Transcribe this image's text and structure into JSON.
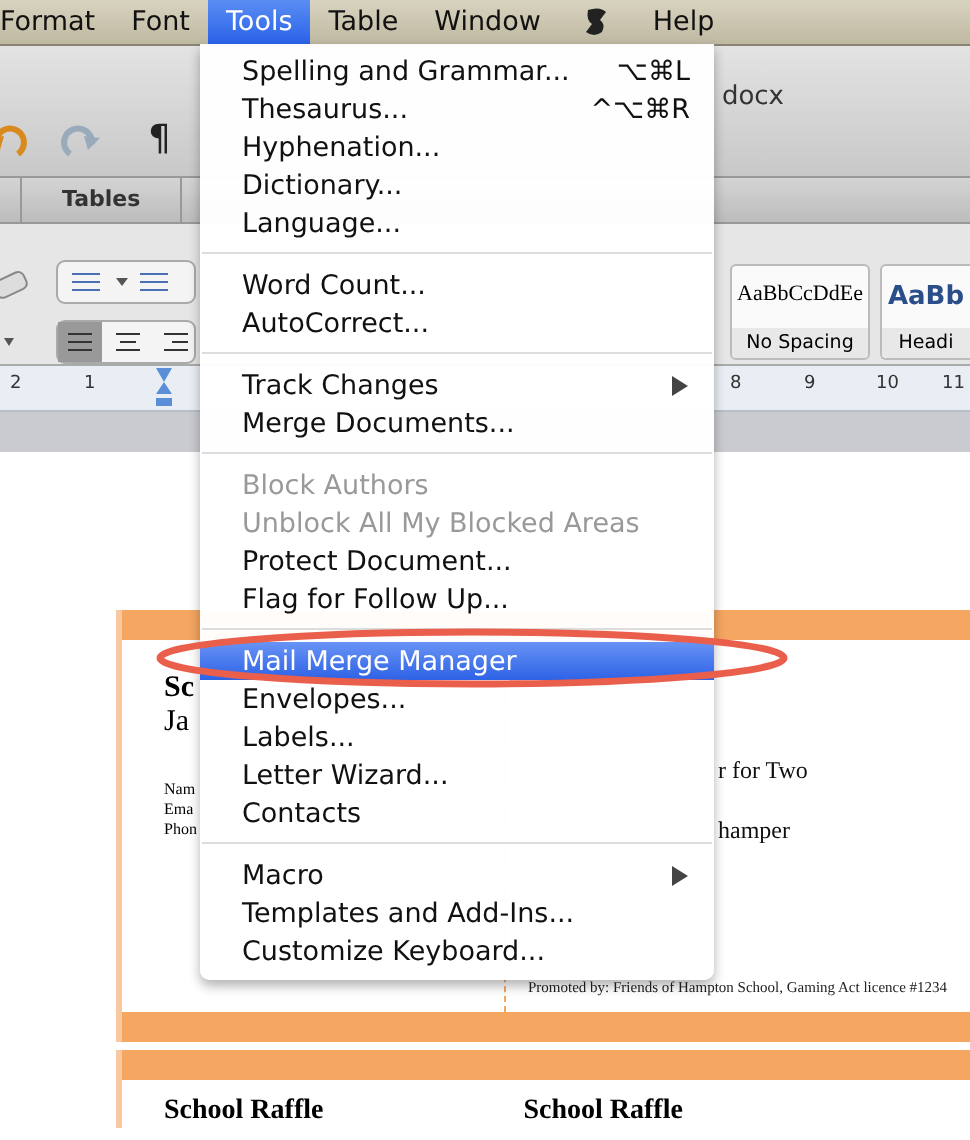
{
  "menu_bar": {
    "items": [
      {
        "label": "Format",
        "selected": false
      },
      {
        "label": "Font",
        "selected": false
      },
      {
        "label": "Tools",
        "selected": true
      },
      {
        "label": "Table",
        "selected": false
      },
      {
        "label": "Window",
        "selected": false
      },
      {
        "kind": "script-icon",
        "selected": false
      },
      {
        "label": "Help",
        "selected": false
      }
    ]
  },
  "document_window": {
    "title_fragment": "docx",
    "pilcrow": "¶",
    "ribbon_tab": "Tables",
    "styles": [
      {
        "sample": "AaBbCcDdEe",
        "name": "No Spacing",
        "kind": "plain"
      },
      {
        "sample": "AaBb",
        "name": "Headi",
        "kind": "heading"
      }
    ],
    "ruler_numbers": [
      "2",
      "1",
      "8",
      "9",
      "10",
      "11"
    ]
  },
  "page": {
    "left_column": [
      "Sc",
      "Ja"
    ],
    "left_fields": [
      "Nam",
      "Ema",
      "Phon"
    ],
    "right_lines": [
      "r for Two",
      "hamper"
    ],
    "footer_line": "Promoted by: Friends of Hampton School, Gaming Act licence #1234",
    "next_card_titles": [
      "School Raffle",
      "School Raffle"
    ]
  },
  "tools_menu": {
    "groups": [
      [
        {
          "label": "Spelling and Grammar...",
          "shortcut": "⌥⌘L",
          "disabled": false,
          "selected": false,
          "submenu": false
        },
        {
          "label": "Thesaurus...",
          "shortcut": "^⌥⌘R",
          "disabled": false,
          "selected": false,
          "submenu": false
        },
        {
          "label": "Hyphenation...",
          "disabled": false,
          "selected": false,
          "submenu": false
        },
        {
          "label": "Dictionary...",
          "disabled": false,
          "selected": false,
          "submenu": false
        },
        {
          "label": "Language...",
          "disabled": false,
          "selected": false,
          "submenu": false
        }
      ],
      [
        {
          "label": "Word Count...",
          "disabled": false,
          "selected": false,
          "submenu": false
        },
        {
          "label": "AutoCorrect...",
          "disabled": false,
          "selected": false,
          "submenu": false
        }
      ],
      [
        {
          "label": "Track Changes",
          "disabled": false,
          "selected": false,
          "submenu": true
        },
        {
          "label": "Merge Documents...",
          "disabled": false,
          "selected": false,
          "submenu": false
        }
      ],
      [
        {
          "label": "Block Authors",
          "disabled": true,
          "selected": false,
          "submenu": false
        },
        {
          "label": "Unblock All My Blocked Areas",
          "disabled": true,
          "selected": false,
          "submenu": false
        },
        {
          "label": "Protect Document...",
          "disabled": false,
          "selected": false,
          "submenu": false
        },
        {
          "label": "Flag for Follow Up...",
          "disabled": false,
          "selected": false,
          "submenu": false
        }
      ],
      [
        {
          "label": "Mail Merge Manager",
          "disabled": false,
          "selected": true,
          "submenu": false
        },
        {
          "label": "Envelopes...",
          "disabled": false,
          "selected": false,
          "submenu": false
        },
        {
          "label": "Labels...",
          "disabled": false,
          "selected": false,
          "submenu": false
        },
        {
          "label": "Letter Wizard...",
          "disabled": false,
          "selected": false,
          "submenu": false
        },
        {
          "label": "Contacts",
          "disabled": false,
          "selected": false,
          "submenu": false
        }
      ],
      [
        {
          "label": "Macro",
          "disabled": false,
          "selected": false,
          "submenu": true
        },
        {
          "label": "Templates and Add-Ins...",
          "disabled": false,
          "selected": false,
          "submenu": false
        },
        {
          "label": "Customize Keyboard...",
          "disabled": false,
          "selected": false,
          "submenu": false
        }
      ]
    ]
  }
}
